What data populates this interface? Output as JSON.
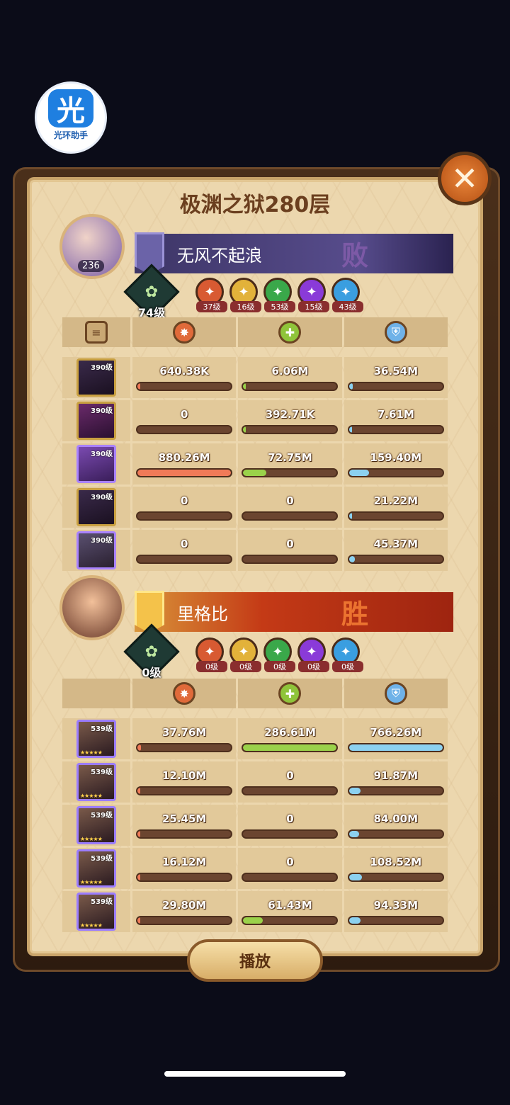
{
  "logo": {
    "glyph": "光",
    "text": "光环助手"
  },
  "close_label": "✕",
  "title": "极渊之狱280层",
  "team1": {
    "avatar_level": "236",
    "name": "无风不起浪",
    "result": "败",
    "level": "74级",
    "artifacts": [
      {
        "level": "37级",
        "color": "#d85a32"
      },
      {
        "level": "16级",
        "color": "#e2b23a"
      },
      {
        "level": "53级",
        "color": "#3aa84a"
      },
      {
        "level": "15级",
        "color": "#8a3ad8"
      },
      {
        "level": "43级",
        "color": "#3a9ee0"
      }
    ],
    "rows": [
      {
        "hero_level": "390级",
        "damage": "640.38K",
        "heal": "6.06M",
        "tank": "36.54M",
        "damage_pct": 0.01,
        "heal_pct": 0.02,
        "tank_pct": 0.04
      },
      {
        "hero_level": "390级",
        "damage": "0",
        "heal": "392.71K",
        "tank": "7.61M",
        "damage_pct": 0,
        "heal_pct": 0.01,
        "tank_pct": 0.01
      },
      {
        "hero_level": "390级",
        "damage": "880.26M",
        "heal": "72.75M",
        "tank": "159.40M",
        "damage_pct": 1,
        "heal_pct": 0.25,
        "tank_pct": 0.21
      },
      {
        "hero_level": "390级",
        "damage": "0",
        "heal": "0",
        "tank": "21.22M",
        "damage_pct": 0,
        "heal_pct": 0,
        "tank_pct": 0.03
      },
      {
        "hero_level": "390级",
        "damage": "0",
        "heal": "0",
        "tank": "45.37M",
        "damage_pct": 0,
        "heal_pct": 0,
        "tank_pct": 0.06
      }
    ]
  },
  "team2": {
    "name": "里格比",
    "result": "胜",
    "level": "0级",
    "artifacts": [
      {
        "level": "0级",
        "color": "#d85a32"
      },
      {
        "level": "0级",
        "color": "#e2b23a"
      },
      {
        "level": "0级",
        "color": "#3aa84a"
      },
      {
        "level": "0级",
        "color": "#8a3ad8"
      },
      {
        "level": "0级",
        "color": "#3a9ee0"
      }
    ],
    "rows": [
      {
        "hero_level": "539级",
        "stars": "★★★★★",
        "damage": "37.76M",
        "heal": "286.61M",
        "tank": "766.26M",
        "damage_pct": 0.04,
        "heal_pct": 1,
        "tank_pct": 1
      },
      {
        "hero_level": "539级",
        "stars": "★★★★★",
        "damage": "12.10M",
        "heal": "0",
        "tank": "91.87M",
        "damage_pct": 0.01,
        "heal_pct": 0,
        "tank_pct": 0.12
      },
      {
        "hero_level": "539级",
        "stars": "★★★★★",
        "damage": "25.45M",
        "heal": "0",
        "tank": "84.00M",
        "damage_pct": 0.03,
        "heal_pct": 0,
        "tank_pct": 0.11
      },
      {
        "hero_level": "539级",
        "stars": "★★★★★",
        "damage": "16.12M",
        "heal": "0",
        "tank": "108.52M",
        "damage_pct": 0.02,
        "heal_pct": 0,
        "tank_pct": 0.14
      },
      {
        "hero_level": "539级",
        "stars": "★★★★★",
        "damage": "29.80M",
        "heal": "61.43M",
        "tank": "94.33M",
        "damage_pct": 0.03,
        "heal_pct": 0.21,
        "tank_pct": 0.12
      }
    ]
  },
  "play_label": "播放"
}
